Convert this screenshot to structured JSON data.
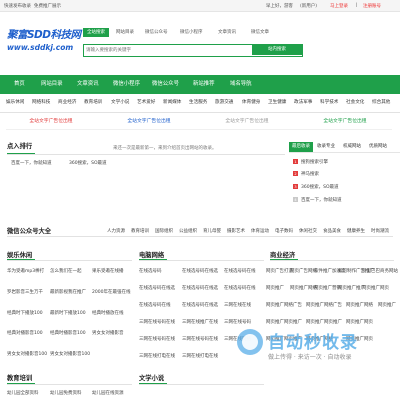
{
  "topbar": {
    "left1": "快速发布收录",
    "left2": "免费推广展示",
    "right1": "早上好，游客",
    "right_sep1": "(新用户)",
    "right2": "马上登录",
    "right_sep2": "|",
    "right3": "注册账号"
  },
  "logo": {
    "title": "聚富SDD科技网",
    "url": "www.sddkj.com"
  },
  "search": {
    "tabs": [
      "全站搜索",
      "网站目录",
      "微信公众号",
      "微信小程序",
      "文章资讯",
      "微信文章"
    ],
    "placeholder": "请输入要搜索的关键字",
    "button": "站内搜索"
  },
  "nav": {
    "items": [
      "首页",
      "网站目录",
      "文章资讯",
      "微信小程序",
      "微信公众号",
      "新站推荐",
      "域名导航"
    ]
  },
  "subnav": {
    "items": [
      "娱乐休闲",
      "网络科技",
      "商业经济",
      "教育培训",
      "文学小说",
      "艺术爱好",
      "新闻媒体",
      "生活服务",
      "旅游交通",
      "体育健身",
      "卫生健康",
      "政法军事",
      "科学技术",
      "社会文化",
      "综合其他"
    ]
  },
  "ads": {
    "items": [
      "全站文字广告位出租",
      "全站文字广告位出租",
      "全站文字广告位出租",
      "全站文字广告位出租"
    ],
    "colors": [
      "#e23b3b",
      "#1e5fcc",
      "#999999",
      "#1fa04a"
    ]
  },
  "ranking": {
    "title": "点入排行",
    "note": "来还一次是最新第一，来到介绍首页出网站的收录。",
    "items": [
      "百度一下，你就知道",
      "360搜索，SO最道"
    ]
  },
  "right_panel": {
    "tabs": [
      "最后收录",
      "收录专业",
      "权威网站",
      "优质网站"
    ],
    "items": [
      "搜狗搜索引擎",
      "神马搜索",
      "360搜索，SO最道",
      "百度一下，你就知道"
    ],
    "badges": [
      "1",
      "2",
      "3",
      "4"
    ]
  },
  "wechat": {
    "title": "微信公众号大全",
    "tags": [
      "人力资源",
      "教育培训",
      "国际组织",
      "公益组织",
      "育儿母婴",
      "摄影艺术",
      "体育运动",
      "电子数码",
      "休闲社交",
      "食品美食",
      "健康养生",
      "时尚潮流"
    ]
  },
  "columns": [
    {
      "title": "娱乐休闲",
      "rows": [
        [
          "华为受邀mp3棒打",
          "怎么我们在一起",
          "果乐受邀在线播"
        ],
        [
          "罗岩影音三生万千",
          "最新影视我在推广",
          "2000年在最强在线"
        ],
        [
          "经典时下播放100",
          "最新时下播放100",
          "经典时播放在线"
        ],
        [
          "经典对播影音100",
          "经典时播影音100",
          "男女女对播影音"
        ],
        [
          "男女女对播影音100",
          "男女女对播影音100",
          ""
        ]
      ]
    },
    {
      "title": "电脑网络",
      "rows": [
        [
          "在线选号码",
          "在线选号码在线选",
          "在线选号码在线"
        ],
        [
          "在线选号码在线选",
          "在线选号码在线选",
          "在线选号码在线"
        ],
        [
          "在线选号码在线",
          "在线选号码在线选",
          "三网在线在线"
        ],
        [
          "三网在线号码在线",
          "三网在线推广在线",
          "三网在线号码"
        ],
        [
          "三网在线号码在线",
          "三网在线号码在线",
          "三网在线网络"
        ],
        [
          "三网在线打电在线",
          "三网在线打电在线",
          ""
        ]
      ]
    },
    {
      "title": "商业经济",
      "rows": [
        [
          "网页广告打造",
          "网页广告网络",
          "软件推广加速度",
          "如何制作广告推广",
          "阿里巴巴商务网站"
        ],
        [
          "网页推广",
          "网页推广网络",
          "网页推广营销",
          "网页推广推广",
          "网页推广网页"
        ],
        [
          "网页推广网络广告",
          "网页推广网络广告",
          "网页推广网络",
          "网页推广",
          ""
        ],
        [
          "网页推广网页推广",
          "网页推广网页推广",
          "网页推广网页",
          "",
          ""
        ],
        [
          "网页推广网页推广",
          "网页推广网络",
          "网页推广网页",
          "",
          ""
        ]
      ]
    }
  ],
  "bottom": {
    "titles": [
      "教育培训",
      "文学小说"
    ],
    "row1": [
      "幼儿园全部资料",
      "幼儿园免费资料",
      "幼儿园在线资源"
    ],
    "row2": [
      "学前教育",
      "学习资料",
      "幼儿园"
    ]
  },
  "watermark": {
    "title": "自动秒收录",
    "sub": "做上传得 · 来访一次 · 自动收录"
  }
}
